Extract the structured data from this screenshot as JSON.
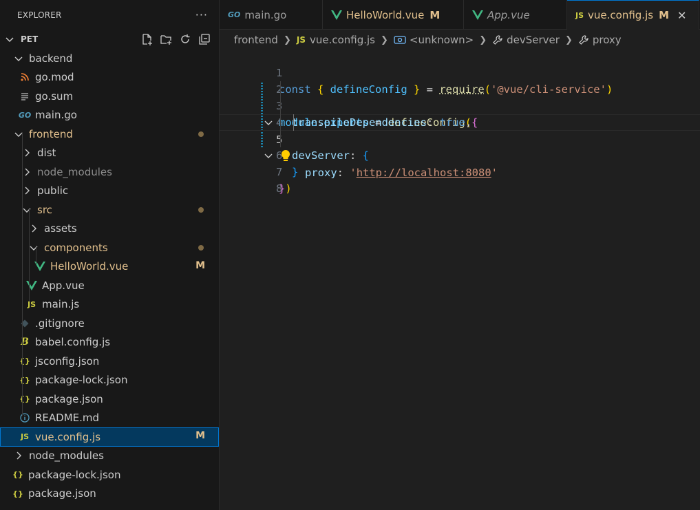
{
  "explorer": {
    "title": "EXPLORER",
    "more_label": "···",
    "root_label": "PET",
    "items": [
      {
        "label": "backend",
        "depth": 1,
        "type": "folder",
        "expanded": true
      },
      {
        "label": "go.mod",
        "depth": 2,
        "type": "file",
        "icon": "rss-icon"
      },
      {
        "label": "go.sum",
        "depth": 2,
        "type": "file",
        "icon": "lines-icon"
      },
      {
        "label": "main.go",
        "depth": 2,
        "type": "file",
        "icon": "go-icon"
      },
      {
        "label": "frontend",
        "depth": 1,
        "type": "folder",
        "expanded": true,
        "modified": true
      },
      {
        "label": "dist",
        "depth": 2,
        "type": "folder",
        "expanded": false
      },
      {
        "label": "node_modules",
        "depth": 2,
        "type": "folder",
        "expanded": false,
        "ignored": true
      },
      {
        "label": "public",
        "depth": 2,
        "type": "folder",
        "expanded": false
      },
      {
        "label": "src",
        "depth": 2,
        "type": "folder",
        "expanded": true,
        "modified": true
      },
      {
        "label": "assets",
        "depth": 3,
        "type": "folder",
        "expanded": false
      },
      {
        "label": "components",
        "depth": 3,
        "type": "folder",
        "expanded": true,
        "modified": true
      },
      {
        "label": "HelloWorld.vue",
        "depth": 4,
        "type": "file",
        "icon": "vue-icon",
        "modified": true,
        "badge": "M"
      },
      {
        "label": "App.vue",
        "depth": 3,
        "type": "file",
        "icon": "vue-icon"
      },
      {
        "label": "main.js",
        "depth": 3,
        "type": "file",
        "icon": "js-icon"
      },
      {
        "label": ".gitignore",
        "depth": 2,
        "type": "file",
        "icon": "git-icon"
      },
      {
        "label": "babel.config.js",
        "depth": 2,
        "type": "file",
        "icon": "babel-icon"
      },
      {
        "label": "jsconfig.json",
        "depth": 2,
        "type": "file",
        "icon": "json-icon"
      },
      {
        "label": "package-lock.json",
        "depth": 2,
        "type": "file",
        "icon": "json-icon"
      },
      {
        "label": "package.json",
        "depth": 2,
        "type": "file",
        "icon": "json-icon"
      },
      {
        "label": "README.md",
        "depth": 2,
        "type": "file",
        "icon": "info-icon"
      },
      {
        "label": "vue.config.js",
        "depth": 2,
        "type": "file",
        "icon": "js-icon",
        "modified": true,
        "badge": "M",
        "selected": true
      },
      {
        "label": "node_modules",
        "depth": 1,
        "type": "folder",
        "expanded": false
      },
      {
        "label": "package-lock.json",
        "depth": 1,
        "type": "file",
        "icon": "json-icon"
      },
      {
        "label": "package.json",
        "depth": 1,
        "type": "file",
        "icon": "json-icon"
      }
    ]
  },
  "tabs": [
    {
      "label": "main.go",
      "icon": "go-icon"
    },
    {
      "label": "HelloWorld.vue",
      "icon": "vue-icon",
      "badge": "M"
    },
    {
      "label": "App.vue",
      "icon": "vue-icon",
      "italic": true
    },
    {
      "label": "vue.config.js",
      "icon": "js-icon",
      "badge": "M",
      "active": true,
      "close": "✕"
    }
  ],
  "breadcrumb": {
    "folder": "frontend",
    "file": "vue.config.js",
    "symbol1": "<unknown>",
    "symbol2": "devServer",
    "symbol3": "proxy"
  },
  "icons": {
    "js": "JS",
    "go": "GO",
    "json": "{}",
    "babel": "B",
    "info": "i"
  },
  "editor": {
    "line_numbers": [
      "1",
      "2",
      "3",
      "4",
      "5",
      "6",
      "7",
      "8"
    ],
    "current_line": 5,
    "tokens": {
      "l1": {
        "const": "const ",
        "b_open": "{ ",
        "name": "defineConfig",
        "b_close": " }",
        "eq": " = ",
        "req": "require",
        "p_open": "(",
        "str": "'@vue/cli-service'",
        "p_close": ")"
      },
      "l2": {
        "module": "module",
        "dot": ".",
        "exports": "exports",
        "eq": " = ",
        "fn": "defineConfig",
        "p_open": "(",
        "b_open": "{"
      },
      "l3": {
        "key": "transpileDependencies",
        "colon": ": ",
        "val": "true",
        "comma": ","
      },
      "l4": {
        "key": "devServer",
        "colon": ": ",
        "b_open": "{"
      },
      "l5": {
        "key": "proxy",
        "colon": ": ",
        "q1": "'",
        "url": "http://localhost:8080",
        "q2": "'"
      },
      "l6": {
        "b_close": "}"
      },
      "l7": {
        "b_close": "}",
        "p_close": ")"
      }
    }
  },
  "colors": {
    "accent": "#0078d4",
    "modified": "#e2c08d",
    "vue": "#41b883",
    "js": "#cbcb41"
  }
}
